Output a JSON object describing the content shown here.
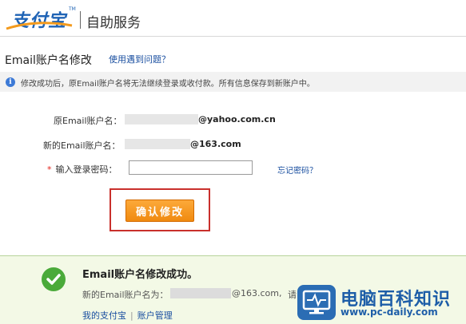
{
  "header": {
    "logo_text": "支付宝",
    "logo_tm": "TM",
    "title": "自助服务"
  },
  "section": {
    "title": "Email账户名修改",
    "help_link": "使用遇到问题？"
  },
  "notice": {
    "icon": "info-icon",
    "text": "修改成功后，原Email账户名将无法继续登录或收付款。所有信息保存到新账户中。"
  },
  "form": {
    "old_label": "原Email账户名：",
    "old_value": "@yahoo.com.cn",
    "new_label": "新的Email账户名：",
    "new_value": "@163.com",
    "required_mark": "*",
    "password_label": "输入登录密码：",
    "password_value": "",
    "forgot_link": "忘记密码？",
    "confirm_button": "确认修改"
  },
  "success": {
    "icon": "check-icon",
    "title": "Email账户名修改成功。",
    "new_label": "新的Email账户名为：",
    "new_value": "@163.com,",
    "tail": "请",
    "links": [
      "我的支付宝",
      "账户管理"
    ],
    "link_separator": "|"
  },
  "watermark": {
    "icon": "monitor-icon",
    "title": "电脑百科知识",
    "url": "www.pc-daily.com"
  },
  "colors": {
    "link": "#1a4fa0",
    "button": "#f08a10",
    "highlight_border": "#c9302c",
    "success_bg": "#f3f9e6",
    "success_icon": "#4aaa3a"
  }
}
